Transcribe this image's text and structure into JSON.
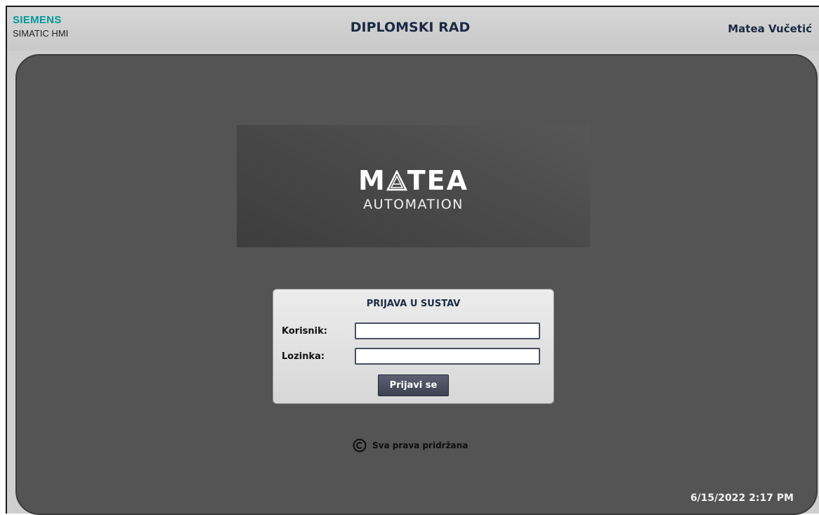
{
  "header": {
    "brand": "SIEMENS",
    "brand_sub": "SIMATIC HMI",
    "title": "DIPLOMSKI RAD",
    "user": "Matea Vučetić"
  },
  "logo": {
    "main_pre": "M",
    "main_post": "TEA",
    "sub": "AUTOMATION"
  },
  "login": {
    "title": "PRIJAVA U SUSTAV",
    "user_label": "Korisnik:",
    "user_value": "",
    "password_label": "Lozinka:",
    "password_value": "",
    "button_label": "Prijavi se"
  },
  "footer": {
    "copyright_icon": "copyright-icon",
    "copyright_text": "Sva prava pridržana",
    "datetime": "6/15/2022 2:17 PM"
  },
  "colors": {
    "brand": "#00999a",
    "panel": "#545454",
    "button": "#4a4f60"
  }
}
